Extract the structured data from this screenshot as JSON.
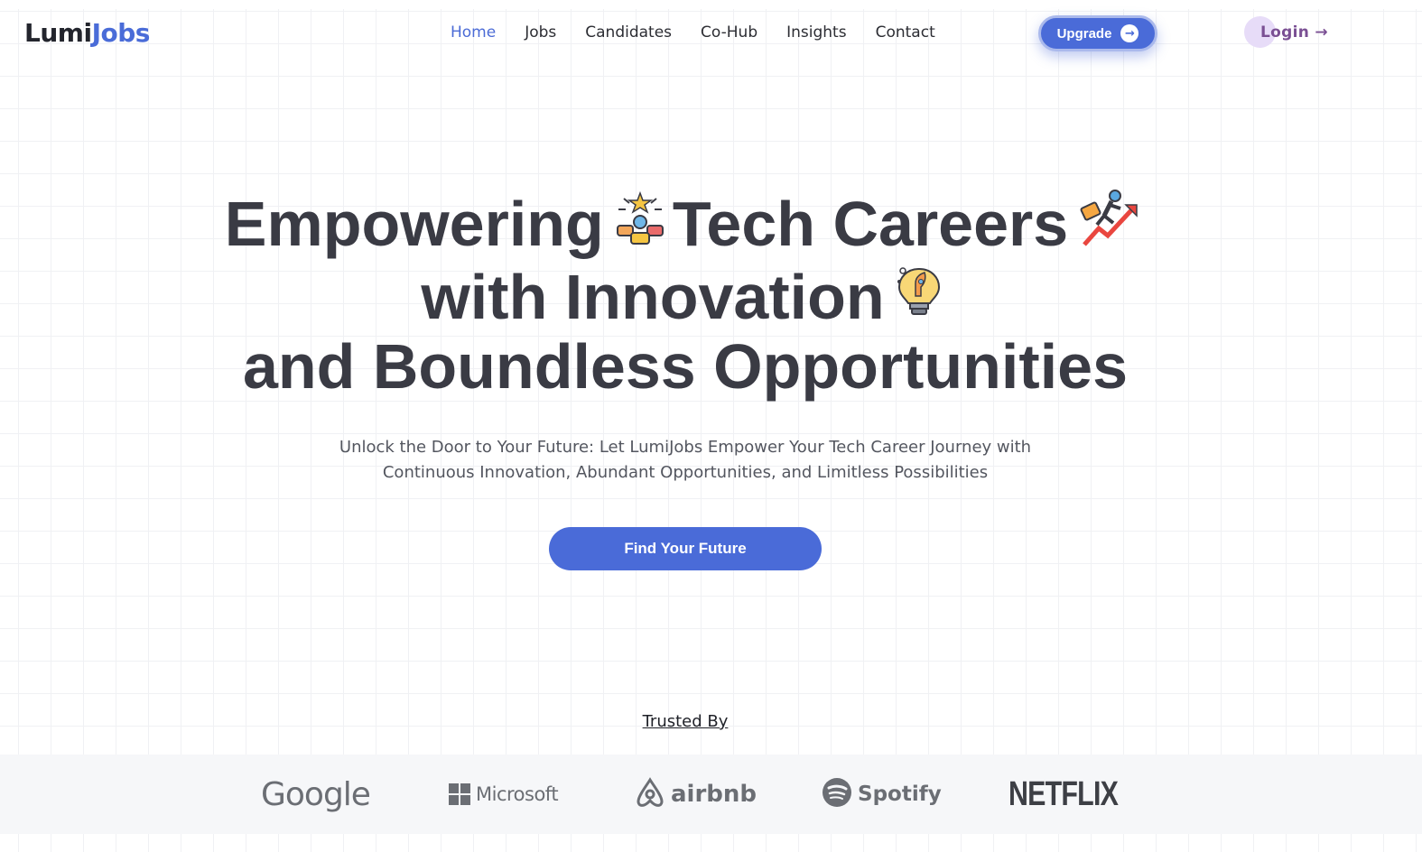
{
  "brand": {
    "name_part1": "Lumi",
    "name_part2": "Jobs"
  },
  "nav": [
    {
      "label": "Home",
      "active": true
    },
    {
      "label": "Jobs"
    },
    {
      "label": "Candidates"
    },
    {
      "label": "Co-Hub"
    },
    {
      "label": "Insights"
    },
    {
      "label": "Contact"
    }
  ],
  "header": {
    "upgrade_label": "Upgrade",
    "upgrade_icon": "arrow-right-circle-icon",
    "login_label": "Login →"
  },
  "hero": {
    "line1_a": "Empowering",
    "line1_b": "Tech Careers",
    "line2": "with Innovation",
    "line3": "and Boundless Opportunities",
    "icons": [
      "teamwork-star-icon",
      "career-growth-icon",
      "rocket-bulb-icon"
    ],
    "subtitle_line1": "Unlock the Door to Your Future: Let LumiJobs Empower Your Tech Career Journey with",
    "subtitle_line2": "Continuous Innovation, Abundant Opportunities, and Limitless Possibilities",
    "cta_label": "Find Your Future"
  },
  "trusted": {
    "heading": "Trusted By",
    "logos": [
      {
        "name": "Google"
      },
      {
        "name": "Microsoft"
      },
      {
        "name": "airbnb"
      },
      {
        "name": "Spotify"
      },
      {
        "name": "NETFLIX"
      }
    ]
  },
  "colors": {
    "accent": "#4a6bd8",
    "login": "#7a4f93",
    "text": "#3a3b44"
  }
}
